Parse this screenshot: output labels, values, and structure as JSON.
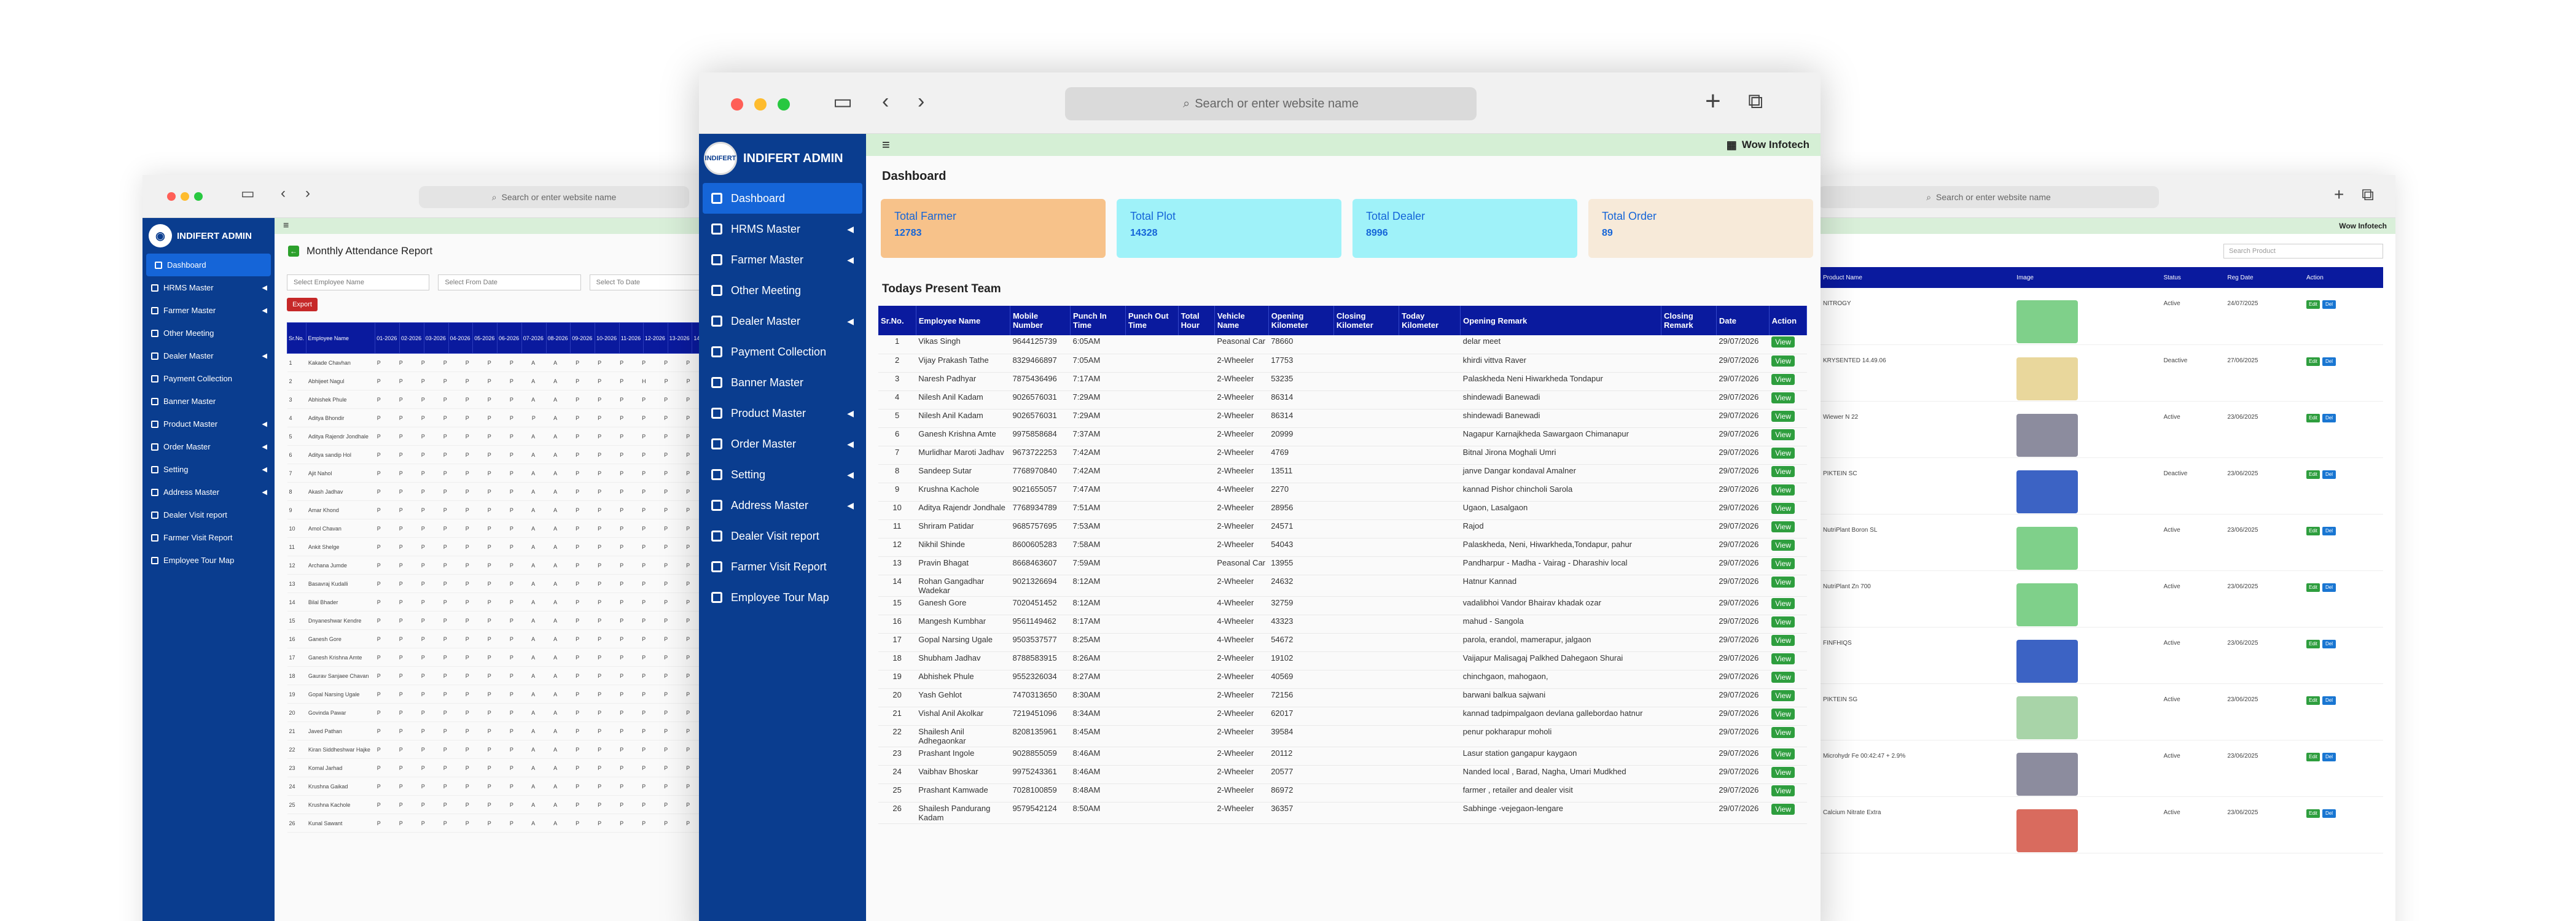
{
  "browser": {
    "url_placeholder": "Search or enter website name"
  },
  "left_window": {
    "brand": "INDIFERT ADMIN",
    "menu": [
      {
        "label": "Dashboard",
        "active": true,
        "arrow": false
      },
      {
        "label": "HRMS Master",
        "arrow": true
      },
      {
        "label": "Farmer Master",
        "arrow": true
      },
      {
        "label": "Other Meeting",
        "arrow": false
      },
      {
        "label": "Dealer Master",
        "arrow": true
      },
      {
        "label": "Payment Collection",
        "arrow": false
      },
      {
        "label": "Banner Master",
        "arrow": false
      },
      {
        "label": "Product Master",
        "arrow": true
      },
      {
        "label": "Order Master",
        "arrow": true
      },
      {
        "label": "Setting",
        "arrow": true
      },
      {
        "label": "Address Master",
        "arrow": true
      },
      {
        "label": "Dealer Visit report",
        "arrow": false
      },
      {
        "label": "Farmer Visit Report",
        "arrow": false
      },
      {
        "label": "Employee Tour Map",
        "arrow": false
      }
    ],
    "title": "Monthly Attendance Report",
    "filter_employee": "Select Employee Name",
    "filter_from": "Select From Date",
    "filter_to": "Select To Date",
    "export_label": "Export",
    "table_headers": [
      "Sr.No.",
      "Employee Name",
      "01-2026",
      "02-2026",
      "03-2026",
      "04-2026",
      "05-2026",
      "06-2026",
      "07-2026",
      "08-2026",
      "09-2026",
      "10-2026",
      "11-2026",
      "12-2026",
      "13-2026",
      "14-2026",
      "15-2026"
    ],
    "rows": [
      {
        "sr": "1",
        "name": "Kakade Chavhan",
        "att": "PPPPPPPAAPPPPPP"
      },
      {
        "sr": "2",
        "name": "Abhijeet Nagul",
        "att": "PPPPPPPAAPPPHPP"
      },
      {
        "sr": "3",
        "name": "Abhishek Phule",
        "att": "PPPPPPPAAPPPPPP"
      },
      {
        "sr": "4",
        "name": "Aditya Bhondir",
        "att": "PPPPPPPPAPPPPPP"
      },
      {
        "sr": "5",
        "name": "Aditya Rajendr Jondhale",
        "att": "PPPPPPPAAPPPPPP"
      },
      {
        "sr": "6",
        "name": "Aditya sandip Hol",
        "att": "PPPPPPPAAPPPPPP"
      },
      {
        "sr": "7",
        "name": "Ajit Nahol",
        "att": "PPPPPPPAAPPPPPP"
      },
      {
        "sr": "8",
        "name": "Akash Jadhav",
        "att": "PPPPPPPAAPPPPPP"
      },
      {
        "sr": "9",
        "name": "Amar Khond",
        "att": "PPPPPPPAAPPPPPP"
      },
      {
        "sr": "10",
        "name": "Amol Chavan",
        "att": "PPPPPPPAAPPPPPP"
      },
      {
        "sr": "11",
        "name": "Ankit Shelge",
        "att": "PPPPPPPAAPPPPPP"
      },
      {
        "sr": "12",
        "name": "Archana Jumde",
        "att": "PPPPPPPAAPPPPPP"
      },
      {
        "sr": "13",
        "name": "Basavraj Kudalli",
        "att": "PPPPPPPAAPPPPPP"
      },
      {
        "sr": "14",
        "name": "Bilal Bhader",
        "att": "PPPPPPPAAPPPPPP"
      },
      {
        "sr": "15",
        "name": "Dnyaneshwar Kendre",
        "att": "PPPPPPPAAPPPPPP"
      },
      {
        "sr": "16",
        "name": "Ganesh Gore",
        "att": "PPPPPPPAAPPPPPP"
      },
      {
        "sr": "17",
        "name": "Ganesh Krishna Amte",
        "att": "PPPPPPPAAPPPPPP"
      },
      {
        "sr": "18",
        "name": "Gaurav Sanjaee Chavan",
        "att": "PPPPPPPAAPPPPPP"
      },
      {
        "sr": "19",
        "name": "Gopal Narsing Ugale",
        "att": "PPPPPPPAAPPPPPP"
      },
      {
        "sr": "20",
        "name": "Govinda Pawar",
        "att": "PPPPPPPAAPPPPPP"
      },
      {
        "sr": "21",
        "name": "Javed Pathan",
        "att": "PPPPPPPAAPPPPPP"
      },
      {
        "sr": "22",
        "name": "Kiran Siddheshwar Hajke",
        "att": "PPPPPPPAAPPPPPP"
      },
      {
        "sr": "23",
        "name": "Komal Jarhad",
        "att": "PPPPPPPAAPPPPPP"
      },
      {
        "sr": "24",
        "name": "Krushna Gaikad",
        "att": "PPPPPPPAAPPPPPP"
      },
      {
        "sr": "25",
        "name": "Krushna Kachole",
        "att": "PPPPPPPAAPPPPPP"
      },
      {
        "sr": "26",
        "name": "Kunal Sawant",
        "att": "PPPPPPPAAPPPPPP"
      }
    ]
  },
  "right_window": {
    "company": "Wow Infotech",
    "search_placeholder": "Search Product",
    "headers": [
      "Product Name",
      "Image",
      "Status",
      "Reg Date",
      "Action"
    ],
    "rows": [
      {
        "name": "NITROGY",
        "status": "Active",
        "date": "24/07/2025",
        "color": "#7fd08a"
      },
      {
        "name": "KRYSENTED 14.49.06",
        "status": "Deactive",
        "date": "27/06/2025",
        "color": "#e9d79c"
      },
      {
        "name": "Wiewer N 22",
        "status": "Active",
        "date": "23/06/2025",
        "color": "#8c8c9e"
      },
      {
        "name": "PIKTEIN SC",
        "status": "Deactive",
        "date": "23/06/2025",
        "color": "#3c63c4"
      },
      {
        "name": "NutriPlant Boron SL",
        "status": "Active",
        "date": "23/06/2025",
        "color": "#7fd08a"
      },
      {
        "name": "NutriPlant Zn 700",
        "status": "Active",
        "date": "23/06/2025",
        "color": "#7fd08a"
      },
      {
        "name": "FINFHIQS",
        "status": "Active",
        "date": "23/06/2025",
        "color": "#3c63c4"
      },
      {
        "name": "PIKTEIN SG",
        "status": "Active",
        "date": "23/06/2025",
        "color": "#a8d4a8"
      },
      {
        "name": "Microhydr Fe 00:42:47 + 2.9%",
        "status": "Active",
        "date": "23/06/2025",
        "color": "#8c8c9e"
      },
      {
        "name": "Calcium Nitrate Extra",
        "status": "Active",
        "date": "23/06/2025",
        "color": "#d96b5e"
      }
    ],
    "edit_label": "Edit",
    "delete_label": "Del"
  },
  "front_window": {
    "brand": "INDIFERT ADMIN",
    "logo_text": "INDIFERT",
    "company": "Wow Infotech",
    "menu": [
      {
        "label": "Dashboard",
        "active": true,
        "arrow": false
      },
      {
        "label": "HRMS Master",
        "arrow": true
      },
      {
        "label": "Farmer Master",
        "arrow": true
      },
      {
        "label": "Other Meeting",
        "arrow": false
      },
      {
        "label": "Dealer Master",
        "arrow": true
      },
      {
        "label": "Payment Collection",
        "arrow": false
      },
      {
        "label": "Banner Master",
        "arrow": false
      },
      {
        "label": "Product Master",
        "arrow": true
      },
      {
        "label": "Order Master",
        "arrow": true
      },
      {
        "label": "Setting",
        "arrow": true
      },
      {
        "label": "Address Master",
        "arrow": true
      },
      {
        "label": "Dealer Visit report",
        "arrow": false
      },
      {
        "label": "Farmer Visit Report",
        "arrow": false
      },
      {
        "label": "Employee Tour Map",
        "arrow": false
      }
    ],
    "page_title": "Dashboard",
    "cards": [
      {
        "label": "Total Farmer",
        "value": "12783",
        "kind": "farmer"
      },
      {
        "label": "Total Plot",
        "value": "14328",
        "kind": "plot"
      },
      {
        "label": "Total Dealer",
        "value": "8996",
        "kind": "dealer"
      },
      {
        "label": "Total Order",
        "value": "89",
        "kind": "order"
      }
    ],
    "section_title": "Todays Present Team",
    "table_headers": [
      "Sr.No.",
      "Employee Name",
      "Mobile Number",
      "Punch In Time",
      "Punch Out Time",
      "Total Hour",
      "Vehicle Name",
      "Opening Kilometer",
      "Closing Kilometer",
      "Today Kilometer",
      "Opening Remark",
      "Closing Remark",
      "Date",
      "Action"
    ],
    "view_label": "View",
    "rows": [
      {
        "sr": "1",
        "name": "Vikas Singh",
        "mobile": "9644125739",
        "in": "6:05AM",
        "vehicle": "Peasonal Car",
        "okm": "78660",
        "remark": "delar meet",
        "date": "29/07/2026"
      },
      {
        "sr": "2",
        "name": "Vijay Prakash Tathe",
        "mobile": "8329466897",
        "in": "7:05AM",
        "vehicle": "2-Wheeler",
        "okm": "17753",
        "remark": "khirdi vittva Raver",
        "date": "29/07/2026"
      },
      {
        "sr": "3",
        "name": "Naresh Padhyar",
        "mobile": "7875436496",
        "in": "7:17AM",
        "vehicle": "2-Wheeler",
        "okm": "53235",
        "remark": "Palaskheda Neni Hiwarkheda Tondapur",
        "date": "29/07/2026"
      },
      {
        "sr": "4",
        "name": "Nilesh Anil Kadam",
        "mobile": "9026576031",
        "in": "7:29AM",
        "vehicle": "2-Wheeler",
        "okm": "86314",
        "remark": "shindewadi Banewadi",
        "date": "29/07/2026"
      },
      {
        "sr": "5",
        "name": "Nilesh Anil Kadam",
        "mobile": "9026576031",
        "in": "7:29AM",
        "vehicle": "2-Wheeler",
        "okm": "86314",
        "remark": "shindewadi Banewadi",
        "date": "29/07/2026"
      },
      {
        "sr": "6",
        "name": "Ganesh Krishna Amte",
        "mobile": "9975858684",
        "in": "7:37AM",
        "vehicle": "2-Wheeler",
        "okm": "20999",
        "remark": "Nagapur Karnajkheda Sawargaon Chimanapur",
        "date": "29/07/2026"
      },
      {
        "sr": "7",
        "name": "Murlidhar Maroti Jadhav",
        "mobile": "9673722253",
        "in": "7:42AM",
        "vehicle": "2-Wheeler",
        "okm": "4769",
        "remark": "Bitnal Jirona Moghali Umri",
        "date": "29/07/2026"
      },
      {
        "sr": "8",
        "name": "Sandeep Sutar",
        "mobile": "7768970840",
        "in": "7:42AM",
        "vehicle": "2-Wheeler",
        "okm": "13511",
        "remark": "janve Dangar kondaval Amalner",
        "date": "29/07/2026"
      },
      {
        "sr": "9",
        "name": "Krushna Kachole",
        "mobile": "9021655057",
        "in": "7:47AM",
        "vehicle": "4-Wheeler",
        "okm": "2270",
        "remark": "kannad Pishor chincholi Sarola",
        "date": "29/07/2026"
      },
      {
        "sr": "10",
        "name": "Aditya Rajendr Jondhale",
        "mobile": "7768934789",
        "in": "7:51AM",
        "vehicle": "2-Wheeler",
        "okm": "28956",
        "remark": "Ugaon, Lasalgaon",
        "date": "29/07/2026"
      },
      {
        "sr": "11",
        "name": "Shriram Patidar",
        "mobile": "9685757695",
        "in": "7:53AM",
        "vehicle": "2-Wheeler",
        "okm": "24571",
        "remark": "Rajod",
        "date": "29/07/2026"
      },
      {
        "sr": "12",
        "name": "Nikhil Shinde",
        "mobile": "8600605283",
        "in": "7:58AM",
        "vehicle": "2-Wheeler",
        "okm": "54043",
        "remark": "Palaskheda, Neni, Hiwarkheda,Tondapur, pahur",
        "date": "29/07/2026"
      },
      {
        "sr": "13",
        "name": "Pravin Bhagat",
        "mobile": "8668463607",
        "in": "7:59AM",
        "vehicle": "Peasonal Car",
        "okm": "13955",
        "remark": "Pandharpur - Madha - Vairag - Dharashiv local",
        "date": "29/07/2026"
      },
      {
        "sr": "14",
        "name": "Rohan Gangadhar Wadekar",
        "mobile": "9021326694",
        "in": "8:12AM",
        "vehicle": "2-Wheeler",
        "okm": "24632",
        "remark": "Hatnur Kannad",
        "date": "29/07/2026"
      },
      {
        "sr": "15",
        "name": "Ganesh Gore",
        "mobile": "7020451452",
        "in": "8:12AM",
        "vehicle": "4-Wheeler",
        "okm": "32759",
        "remark": "vadalibhoi Vandor Bhairav khadak ozar",
        "date": "29/07/2026"
      },
      {
        "sr": "16",
        "name": "Mangesh Kumbhar",
        "mobile": "9561149462",
        "in": "8:17AM",
        "vehicle": "4-Wheeler",
        "okm": "43323",
        "remark": "mahud - Sangola",
        "date": "29/07/2026"
      },
      {
        "sr": "17",
        "name": "Gopal Narsing Ugale",
        "mobile": "9503537577",
        "in": "8:25AM",
        "vehicle": "4-Wheeler",
        "okm": "54672",
        "remark": "parola, erandol, mamerapur, jalgaon",
        "date": "29/07/2026"
      },
      {
        "sr": "18",
        "name": "Shubham Jadhav",
        "mobile": "8788583915",
        "in": "8:26AM",
        "vehicle": "2-Wheeler",
        "okm": "19102",
        "remark": "Vaijapur Malisagaj Palkhed Dahegaon Shurai",
        "date": "29/07/2026"
      },
      {
        "sr": "19",
        "name": "Abhishek Phule",
        "mobile": "9552326034",
        "in": "8:27AM",
        "vehicle": "2-Wheeler",
        "okm": "40569",
        "remark": "chinchgaon, mahogaon,",
        "date": "29/07/2026"
      },
      {
        "sr": "20",
        "name": "Yash Gehlot",
        "mobile": "7470313650",
        "in": "8:30AM",
        "vehicle": "2-Wheeler",
        "okm": "72156",
        "remark": "barwani balkua sajwani",
        "date": "29/07/2026"
      },
      {
        "sr": "21",
        "name": "Vishal Anil Akolkar",
        "mobile": "7219451096",
        "in": "8:34AM",
        "vehicle": "2-Wheeler",
        "okm": "62017",
        "remark": "kannad tadpimpalgaon devlana gallebordao hatnur",
        "date": "29/07/2026"
      },
      {
        "sr": "22",
        "name": "Shailesh Anil Adhegaonkar",
        "mobile": "8208135961",
        "in": "8:45AM",
        "vehicle": "2-Wheeler",
        "okm": "39584",
        "remark": "penur pokharapur moholi",
        "date": "29/07/2026"
      },
      {
        "sr": "23",
        "name": "Prashant Ingole",
        "mobile": "9028855059",
        "in": "8:46AM",
        "vehicle": "2-Wheeler",
        "okm": "20112",
        "remark": "Lasur station gangapur kaygaon",
        "date": "29/07/2026"
      },
      {
        "sr": "24",
        "name": "Vaibhav Bhoskar",
        "mobile": "9975243361",
        "in": "8:46AM",
        "vehicle": "2-Wheeler",
        "okm": "20577",
        "remark": "Nanded local , Barad, Nagha, Umari Mudkhed",
        "date": "29/07/2026"
      },
      {
        "sr": "25",
        "name": "Prashant Kamwade",
        "mobile": "7028100859",
        "in": "8:48AM",
        "vehicle": "2-Wheeler",
        "okm": "86972",
        "remark": "farmer , retailer and dealer visit",
        "date": "29/07/2026"
      },
      {
        "sr": "26",
        "name": "Shailesh Pandurang Kadam",
        "mobile": "9579542124",
        "in": "8:50AM",
        "vehicle": "2-Wheeler",
        "okm": "36357",
        "remark": "Sabhinge -vejegaon-lengare",
        "date": "29/07/2026"
      }
    ]
  }
}
